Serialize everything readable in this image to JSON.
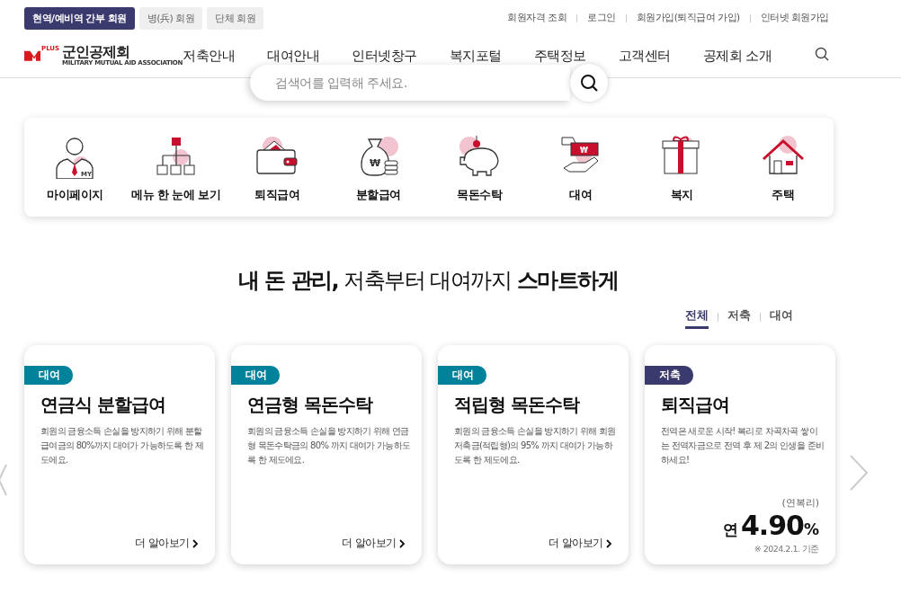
{
  "member_tabs": [
    {
      "label": "현역/예비역 간부 회원",
      "selected": true
    },
    {
      "label": "병(兵) 회원",
      "selected": false
    },
    {
      "label": "단체 회원",
      "selected": false
    }
  ],
  "util_links": [
    "회원자격 조회",
    "로그인",
    "회원가입(퇴직급여 가입)",
    "인터넷 회원가입"
  ],
  "logo": {
    "name": "군인공제회",
    "subtitle": "MILITARY MUTUAL AID ASSOCIATION",
    "badge": "PLUS"
  },
  "nav": [
    "저축안내",
    "대여안내",
    "인터넷창구",
    "복지포털",
    "주택정보",
    "고객센터",
    "공제회 소개"
  ],
  "search": {
    "placeholder": "검색어를 입력해 주세요."
  },
  "quick_menu": [
    {
      "label": "마이페이지",
      "badge": "MY"
    },
    {
      "label": "메뉴 한 눈에 보기"
    },
    {
      "label": "퇴직급여"
    },
    {
      "label": "분할급여",
      "badge": "₩"
    },
    {
      "label": "목돈수탁"
    },
    {
      "label": "대여",
      "badge": "₩"
    },
    {
      "label": "복지"
    },
    {
      "label": "주택"
    }
  ],
  "headline": "**내 돈 관리,** 저축부터 대여까지 **스마트하게**",
  "filter_tabs": [
    {
      "label": "전체",
      "selected": true
    },
    {
      "label": "저축",
      "selected": false
    },
    {
      "label": "대여",
      "selected": false
    }
  ],
  "products": [
    {
      "kind": "link",
      "tag": "대여",
      "color": "#00829b",
      "title": "연금식 분할급여",
      "description": "회원의 금융소득 손실을 방지하기 위해 분할급여금의 80%까지 대여가 가능하도록 한 제도에요.",
      "link": "더 알아보기"
    },
    {
      "kind": "link",
      "tag": "대여",
      "color": "#00829b",
      "title": "연금형 목돈수탁",
      "description": "회원의 금융소득 손실을 방지하기 위해 연금형 목돈수탁금의 80% 까지 대여가 가능하도록 한 제도에요.",
      "link": "더 알아보기"
    },
    {
      "kind": "link",
      "tag": "대여",
      "color": "#00829b",
      "title": "적립형 목돈수탁",
      "description": "회원의 금융소득 손실을 방지하기 위해 회원 저축금(적립형)의 95% 까지 대여가 가능하도록 한 제도에요.",
      "link": "더 알아보기"
    },
    {
      "kind": "rate",
      "tag": "저축",
      "color": "#3a3a6e",
      "title": "퇴직급여",
      "description": "전역은 새로운 시작! 복리로 차곡차곡 쌓이는 전역자금으로 전역 후 제 2의 인생을 준비하세요!",
      "rate_note": "(연복리)",
      "rate_prefix": "연",
      "rate_value": "4.90",
      "rate_unit": "%",
      "rate_date": "※ 2024.2.1. 기준"
    }
  ]
}
